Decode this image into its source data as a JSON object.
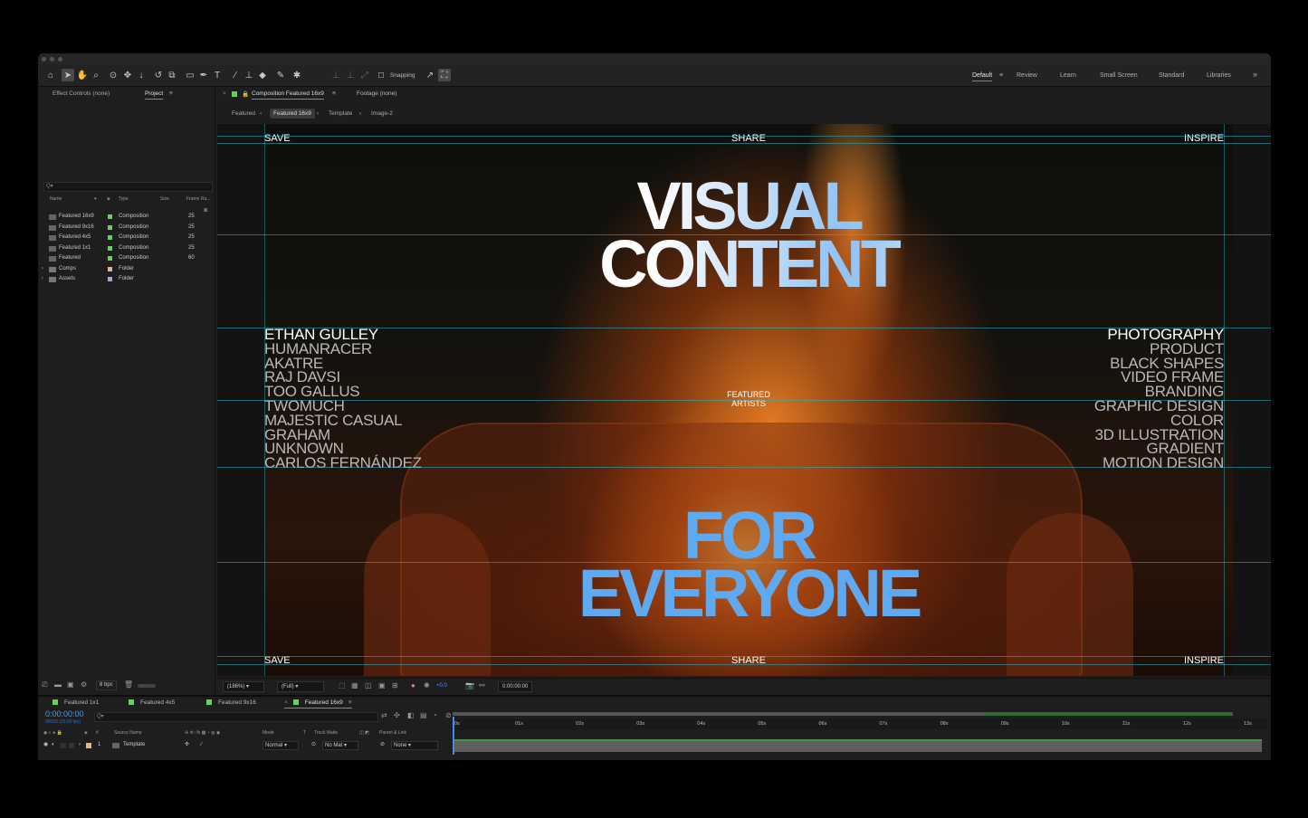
{
  "toolbar": {
    "snapping_label": "Snapping",
    "workspaces": [
      "Default",
      "Review",
      "Learn",
      "Small Screen",
      "Standard",
      "Libraries"
    ],
    "active_workspace": "Default",
    "more_label": "»"
  },
  "left_panel": {
    "tabs": [
      "Effect Controls (none)",
      "Project"
    ],
    "active_tab": "Project",
    "search_placeholder": "Q▾",
    "columns": [
      "Name",
      "Type",
      "Size",
      "Frame Ra..."
    ],
    "items": [
      {
        "name": "Featured 16x9",
        "type": "Composition",
        "frame_rate": "25",
        "color": "#5fd45f"
      },
      {
        "name": "Featured 9x16",
        "type": "Composition",
        "frame_rate": "25",
        "color": "#5fd45f"
      },
      {
        "name": "Featured 4x5",
        "type": "Composition",
        "frame_rate": "25",
        "color": "#5fd45f"
      },
      {
        "name": "Featured 1x1",
        "type": "Composition",
        "frame_rate": "25",
        "color": "#5fd45f"
      },
      {
        "name": "Featured",
        "type": "Composition",
        "frame_rate": "60",
        "color": "#5fd45f"
      },
      {
        "name": "Comps",
        "type": "Folder",
        "frame_rate": "",
        "color": "#e8b48a"
      },
      {
        "name": "Assets",
        "type": "Folder",
        "frame_rate": "",
        "color": "#a9a4d8"
      }
    ],
    "bpc_label": "8 bpc"
  },
  "viewer": {
    "tabs": [
      "Composition Featured 16x9",
      "Footage (none)"
    ],
    "breadcrumbs": [
      "Featured",
      "Featured 16x9",
      "Template",
      "Image-2"
    ],
    "active_crumb": "Featured 16x9",
    "zoom": "(186%)",
    "resolution": "(Full)",
    "exposure": "+0.0",
    "timecode": "0:00:00:00"
  },
  "composition": {
    "top_left": "SAVE",
    "top_center": "SHARE",
    "top_right": "INSPIRE",
    "headline_1": "VISUAL",
    "headline_2": "CONTENT",
    "center_label_1": "FEATURED",
    "center_label_2": "ARTISTS",
    "artists": [
      "ETHAN GULLEY",
      "HUMANRACER",
      "AKATRE",
      "RAJ DAVSI",
      "TOO GALLUS",
      "TWOMUCH",
      "MAJESTIC CASUAL",
      "GRAHAM",
      "UNKNOWN",
      "CARLOS FERNÁNDEZ"
    ],
    "categories": [
      "PHOTOGRAPHY",
      "PRODUCT",
      "BLACK SHAPES",
      "VIDEO FRAME",
      "BRANDING",
      "GRAPHIC DESIGN",
      "COLOR",
      "3D ILLUSTRATION",
      "GRADIENT",
      "MOTION DESIGN"
    ],
    "tagline_1": "FOR",
    "tagline_2": "EVERYONE",
    "bottom_left": "SAVE",
    "bottom_center": "SHARE",
    "bottom_right": "INSPIRE"
  },
  "timeline": {
    "tabs": [
      {
        "label": "Featured 1x1",
        "color": "#5fd45f"
      },
      {
        "label": "Featured 4x5",
        "color": "#5fd45f"
      },
      {
        "label": "Featured 9x16",
        "color": "#5fd45f"
      },
      {
        "label": "Featured 16x9",
        "color": "#5fd45f"
      }
    ],
    "active_tab": "Featured 16x9",
    "current_time": "0:00:00:00",
    "current_frames": "00000 (25.00 fps)",
    "columns": [
      "Source Name",
      "Mode",
      "T",
      "Track Matte",
      "Parent & Link"
    ],
    "ticks": [
      "0s",
      "01s",
      "02s",
      "03s",
      "04s",
      "05s",
      "06s",
      "07s",
      "08s",
      "09s",
      "10s",
      "11s",
      "12s",
      "13s"
    ],
    "layer": {
      "index": "1",
      "name": "Template",
      "mode": "Normal",
      "matte": "No Mat",
      "parent": "None"
    }
  }
}
